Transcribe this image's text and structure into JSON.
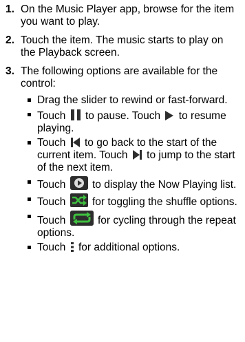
{
  "steps": [
    {
      "number": "1.",
      "text": "On the Music Player app, browse for the item you want to play."
    },
    {
      "number": "2.",
      "text": "Touch the item. The music starts to play on the Playback screen."
    },
    {
      "number": "3.",
      "text": "The following options are available for the control:"
    }
  ],
  "bullets": {
    "b1": {
      "text": "Drag the slider to rewind or fast-forward."
    },
    "b2": {
      "pre": "Touch",
      "mid": "to pause. Touch",
      "post": "to resume playing."
    },
    "b3": {
      "pre": "Touch",
      "mid": "to go back to the start of the current item. Touch",
      "post": "to jump to the start of the next item."
    },
    "b4": {
      "pre": "Touch",
      "post": "to display the Now Playing list."
    },
    "b5": {
      "pre": "Touch",
      "post": "for toggling the shuffle options."
    },
    "b6": {
      "pre": "Touch",
      "post": "for cycling through the repeat options."
    },
    "b7": {
      "pre": "Touch",
      "post": "for additional options."
    }
  },
  "icons": {
    "pause": "pause-icon",
    "play": "play-icon",
    "previous": "previous-track-icon",
    "next": "next-track-icon",
    "now_playing": "now-playing-list-icon",
    "shuffle": "shuffle-icon",
    "repeat": "repeat-icon",
    "menu": "menu-dots-icon"
  },
  "colors": {
    "icon_dark": "#2d2d2d",
    "icon_green": "#3fbf3f"
  }
}
